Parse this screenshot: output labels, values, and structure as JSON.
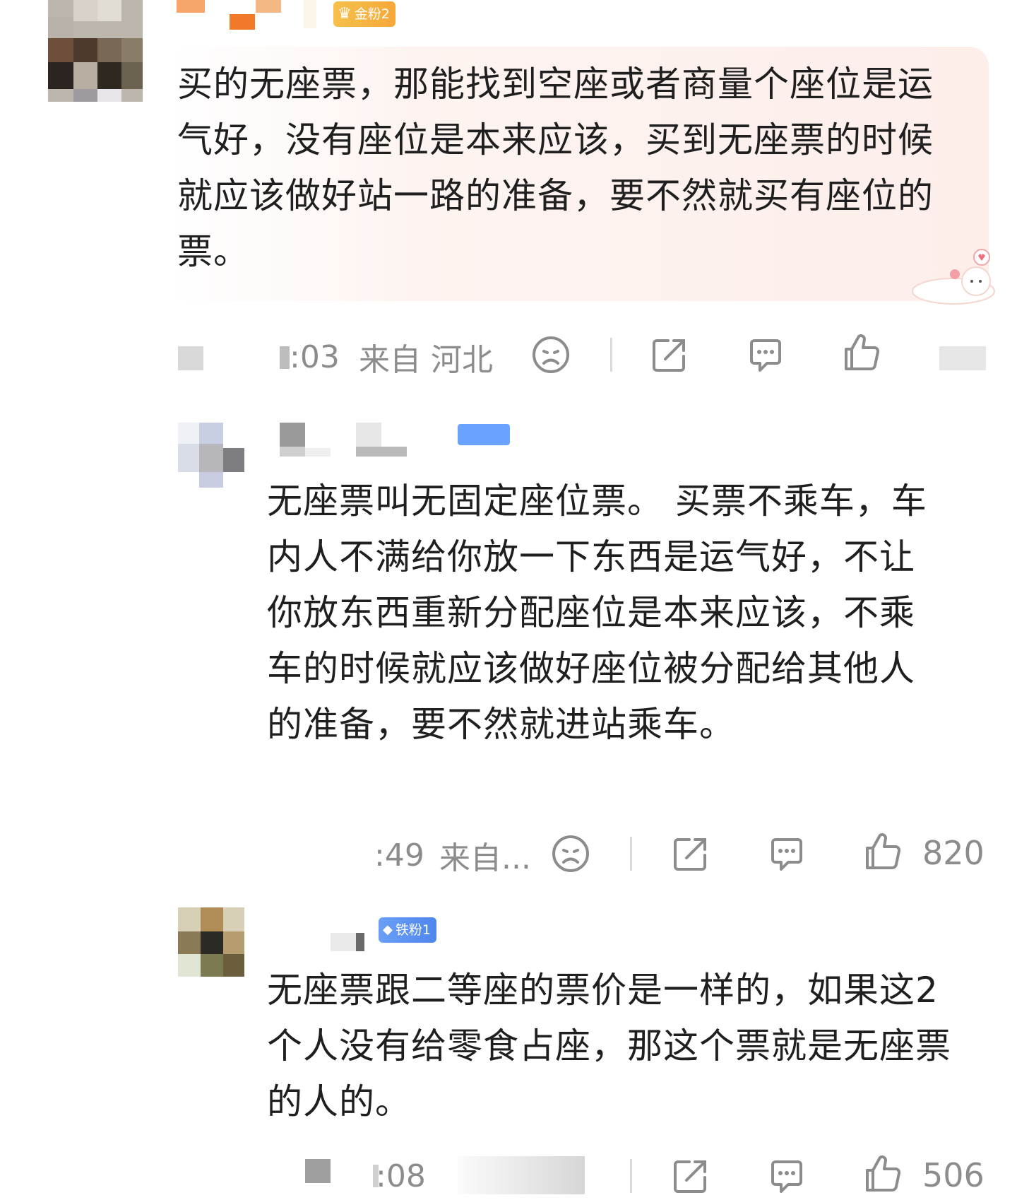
{
  "comments": [
    {
      "badge": "金粉2",
      "text": "买的无座票，那能找到空座或者商量个座位是运气好，没有座位是本来应该，买到无座票的时候就应该做好站一路的准备，要不然就买有座位的票。",
      "time": ":03",
      "location": "来自 河北",
      "like_count": ""
    },
    {
      "badge": "",
      "text": "无座票叫无固定座位票。 买票不乘车，车内人不满给你放一下东西是运气好，不让你放东西重新分配座位是本来应该，不乘车的时候就应该做好座位被分配给其他人的准备，要不然就进站乘车。",
      "time": ":49",
      "location": "来自...",
      "like_count": "820"
    },
    {
      "badge": "铁粉1",
      "text": "无座票跟二等座的票价是一样的，如果这2个人没有给零食占座，那这个票就是无座票的人的。",
      "time": ":08",
      "location": "",
      "like_count": "506"
    }
  ],
  "icons": [
    "sad-face-icon",
    "share-icon",
    "comment-icon",
    "thumbs-up-icon"
  ],
  "colors": {
    "text": "#1f1f1f",
    "meta": "#8c8c8c",
    "bubble": "#fdeeea",
    "badge_gold": "#f6b040",
    "badge_blue": "#5a8ff0"
  }
}
